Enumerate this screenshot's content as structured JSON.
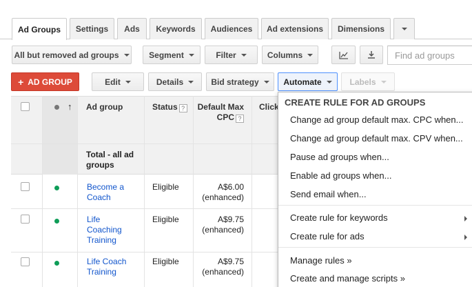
{
  "tabs": [
    {
      "label": "Ad Groups"
    },
    {
      "label": "Settings"
    },
    {
      "label": "Ads"
    },
    {
      "label": "Keywords"
    },
    {
      "label": "Audiences"
    },
    {
      "label": "Ad extensions"
    },
    {
      "label": "Dimensions"
    }
  ],
  "toolbar": {
    "filter_view": "All but removed ad groups",
    "segment": "Segment",
    "filter": "Filter",
    "columns": "Columns",
    "search_placeholder": "Find ad groups"
  },
  "actions": {
    "add": "AD GROUP",
    "edit": "Edit",
    "details": "Details",
    "bid_strategy": "Bid strategy",
    "automate": "Automate",
    "labels": "Labels"
  },
  "table": {
    "headers": {
      "ad_group": "Ad group",
      "status": "Status",
      "default_max_cpc_line1": "Default Max",
      "default_max_cpc_line2": "CPC",
      "clicks": "Click"
    },
    "total_label_line1": "Total - all ad",
    "total_label_line2": "groups",
    "rows": [
      {
        "name_line1": "Become a",
        "name_line2": "Coach",
        "name_line3": "",
        "status": "Eligible",
        "cpc": "A$6.00",
        "cpc_note": "(enhanced)"
      },
      {
        "name_line1": "Life",
        "name_line2": "Coaching",
        "name_line3": "Training",
        "status": "Eligible",
        "cpc": "A$9.75",
        "cpc_note": "(enhanced)"
      },
      {
        "name_line1": "Life Coach",
        "name_line2": "Training",
        "name_line3": "",
        "status": "Eligible",
        "cpc": "A$9.75",
        "cpc_note": "(enhanced)"
      }
    ]
  },
  "menu": {
    "heading": "CREATE RULE FOR AD GROUPS",
    "items": [
      "Change ad group default max. CPC when...",
      "Change ad group default max. CPV when...",
      "Pause ad groups when...",
      "Enable ad groups when...",
      "Send email when..."
    ],
    "submenus": [
      "Create rule for keywords",
      "Create rule for ads"
    ],
    "footer": [
      "Manage rules »",
      "Create and manage scripts »"
    ]
  },
  "colors": {
    "accent_red": "#dd4b39",
    "link_blue": "#1155cc",
    "status_green": "#0f9d58",
    "focus_blue": "#4d90fe"
  }
}
